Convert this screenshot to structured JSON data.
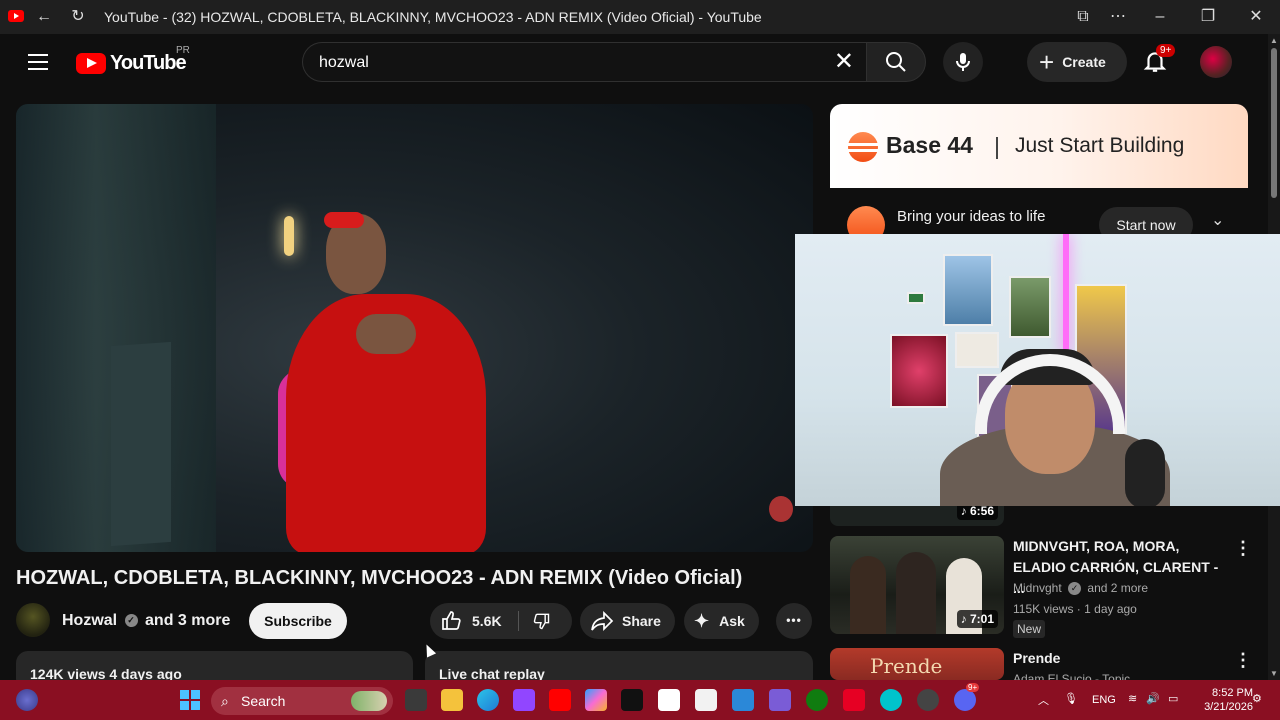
{
  "browser": {
    "tab_title": "YouTube - (32) HOZWAL, CDOBLETA, BLACKINNY, MVCHOO23 - ADN REMIX (Video Oficial) - YouTube"
  },
  "header": {
    "logo_text": "YouTube",
    "country_code": "PR",
    "search_value": "hozwal",
    "create_label": "Create",
    "notifications_badge": "9+"
  },
  "video": {
    "title": "HOZWAL, CDOBLETA, BLACKINNY, MVCHOO23 - ADN REMIX (Video Oficial)",
    "channel": "Hozwal",
    "collab": "and 3 more",
    "subscribe_label": "Subscribe",
    "likes": "5.6K",
    "share_label": "Share",
    "ask_label": "Ask",
    "more_label": "•••",
    "views_date": "124K views  4 days ago",
    "live_chat_label": "Live chat replay"
  },
  "ad": {
    "brand": "Base 44",
    "tagline": "Just Start Building",
    "headline": "Bring your ideas to life",
    "cta": "Start now"
  },
  "related": [
    {
      "duration": "6:56"
    },
    {
      "title": "MIDNVGHT, ROA, MORA, ELADIO CARRIÓN, CLARENT - ...",
      "channel": "Midnvght",
      "collab": "and 2 more",
      "views_age": "115K views · 1 day ago",
      "badge": "New",
      "duration": "7:01"
    },
    {
      "title": "Prende",
      "channel": "Adam El Sucio - Topic"
    }
  ],
  "taskbar": {
    "search_label": "Search",
    "lang": "ENG",
    "time": "8:52 PM",
    "date": "3/21/2026",
    "discord_badge": "9+"
  },
  "colors": {
    "yt_red": "#ff0000",
    "taskbar": "#8a0f22",
    "base44_orange": "#f24d14"
  }
}
